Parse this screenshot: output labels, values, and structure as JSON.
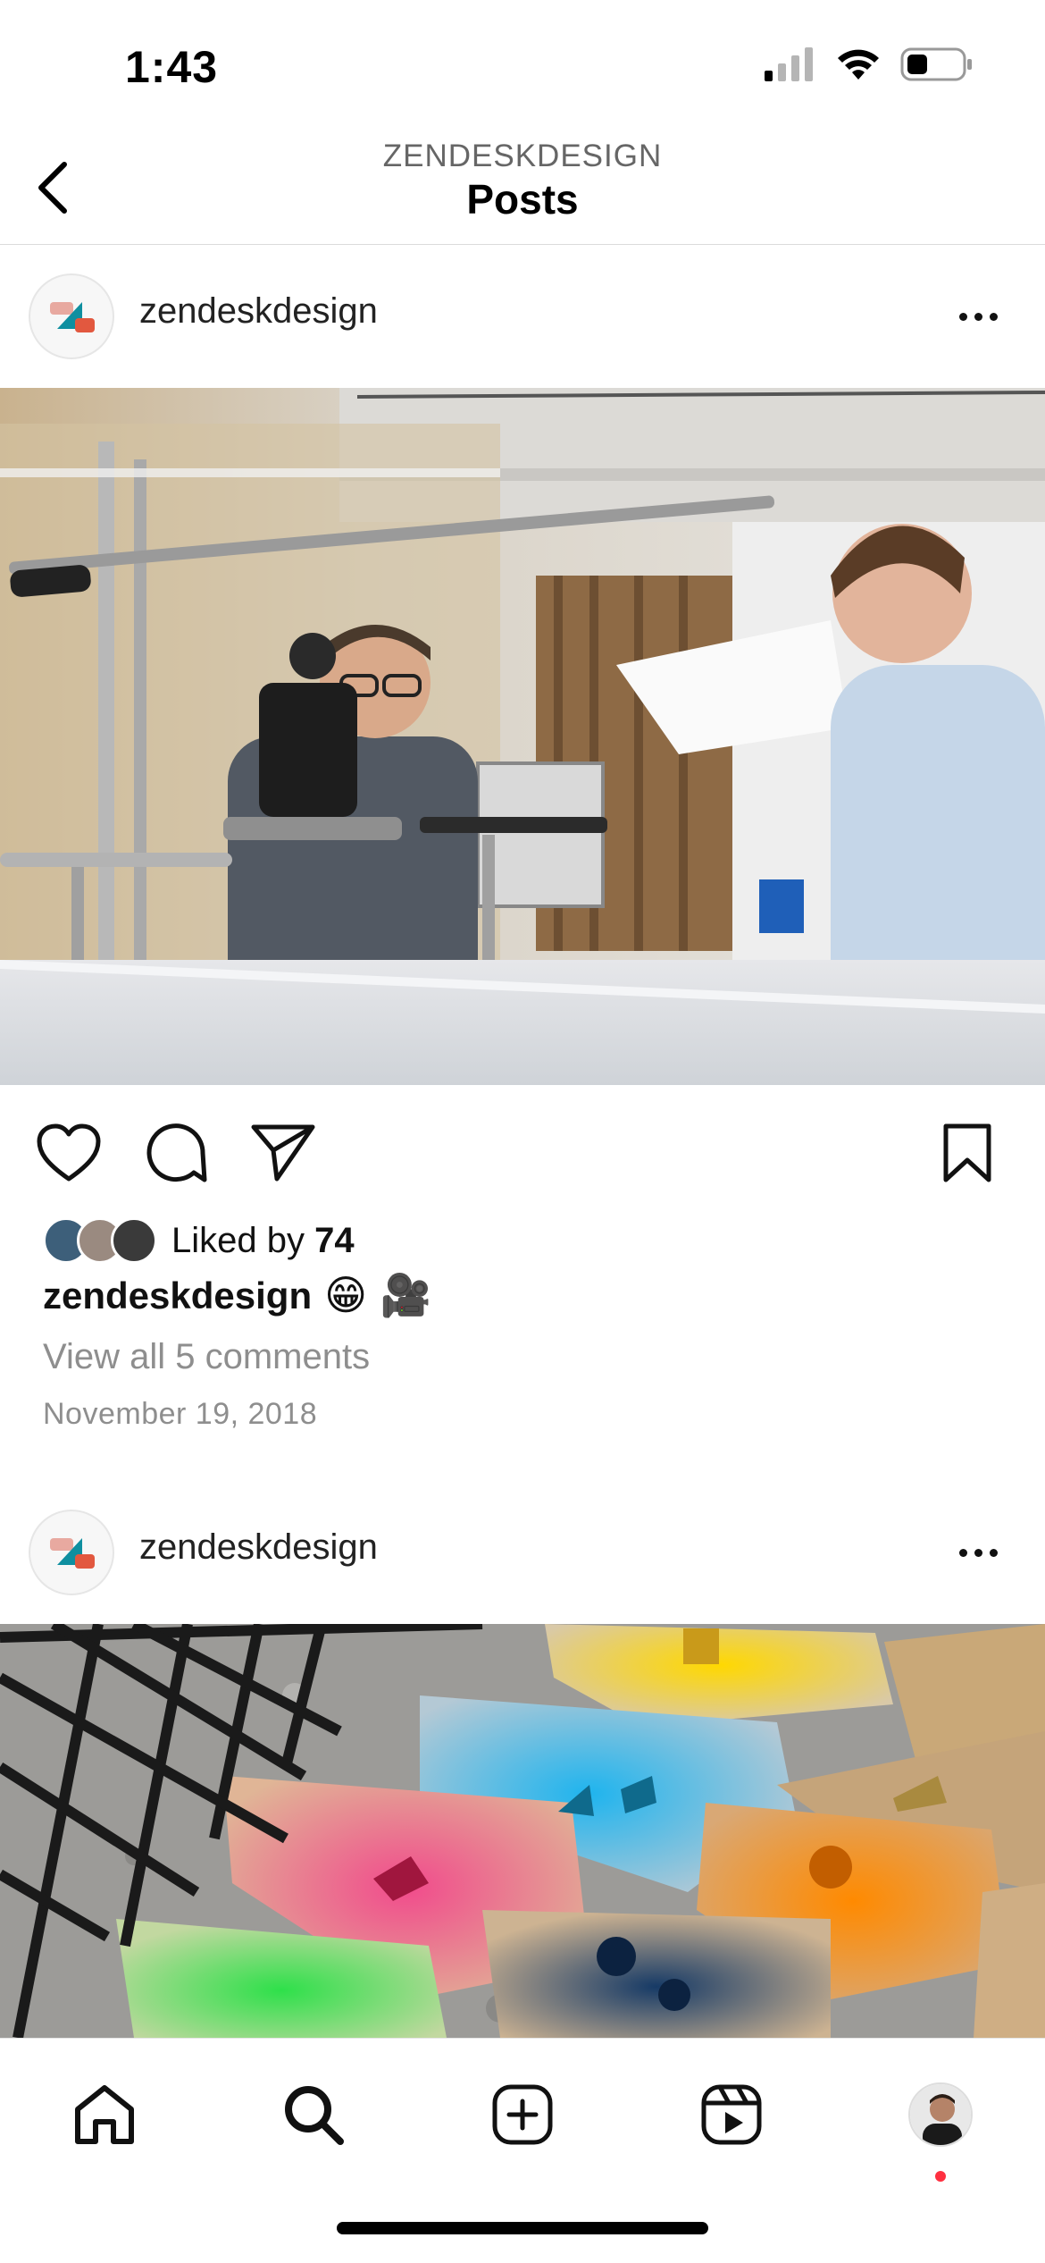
{
  "status_bar": {
    "time": "1:43"
  },
  "header": {
    "subtitle": "ZENDESKDESIGN",
    "title": "Posts"
  },
  "posts": [
    {
      "username": "zendeskdesign",
      "image_alt": "Photo of a camera operator filming in an office studio",
      "likes_prefix": "Liked by ",
      "likes_count": "74",
      "caption_user": "zendeskdesign",
      "caption_emojis": "😁 🎥",
      "comments_link": "View all 5 comments",
      "date": "November 19, 2018"
    },
    {
      "username": "zendeskdesign",
      "image_alt": "Spray-painted cardboard sheets with colored shapes"
    }
  ],
  "nav": {
    "items": [
      "home",
      "search",
      "create",
      "reels",
      "profile"
    ],
    "profile_notification": true
  },
  "colors": {
    "accent_red": "#ff3040",
    "muted_text": "#8e8e8e"
  }
}
